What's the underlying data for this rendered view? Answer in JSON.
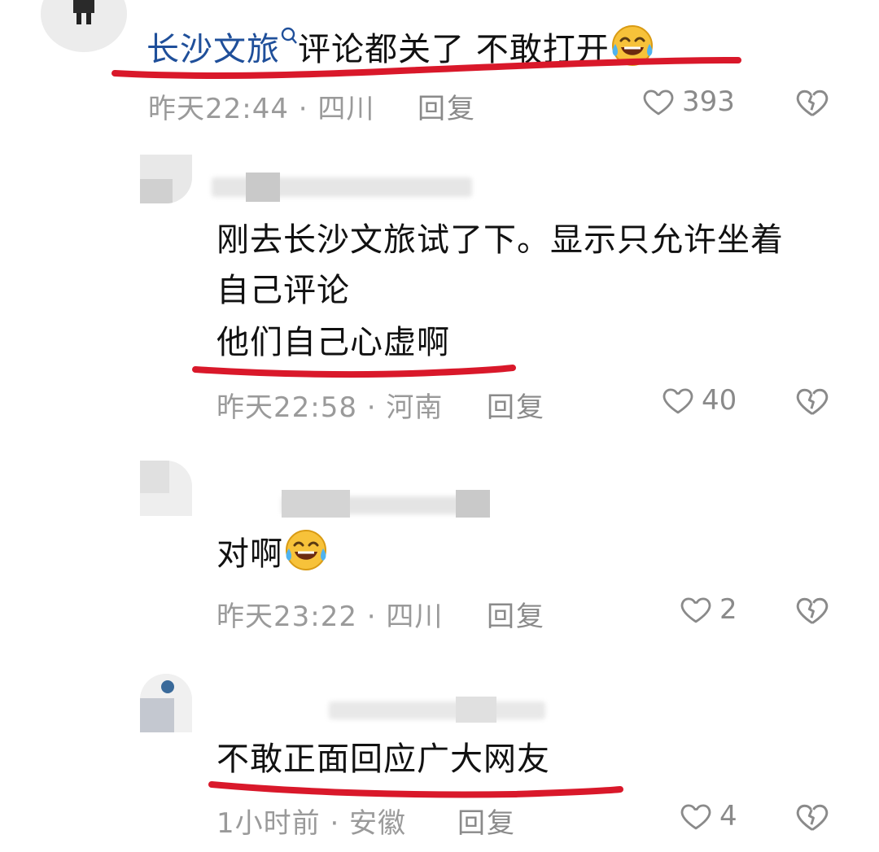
{
  "colors": {
    "author_name": "#1f4f9a",
    "meta": "#9a9a9a",
    "underline": "#d9182a"
  },
  "comments": [
    {
      "author": "长沙文旅",
      "author_badge_icon": "search-icon",
      "lines": [
        "评论都关了 不敢打开"
      ],
      "trailing_emoji": "laughing-crying-emoji",
      "time_location": "昨天22:44 · 四川",
      "reply_label": "回复",
      "likes": "393"
    },
    {
      "lines": [
        "刚去长沙文旅试了下。显示只允许坐着",
        "自己评论",
        "他们自己心虚啊"
      ],
      "time_location": "昨天22:58 · 河南",
      "reply_label": "回复",
      "likes": "40"
    },
    {
      "lines": [
        "对啊"
      ],
      "trailing_emoji": "laughing-crying-emoji",
      "time_location": "昨天23:22 · 四川",
      "reply_label": "回复",
      "likes": "2"
    },
    {
      "lines": [
        "不敢正面回应广大网友"
      ],
      "time_location": "1小时前 · 安徽",
      "reply_label": "回复",
      "likes": "4"
    }
  ]
}
